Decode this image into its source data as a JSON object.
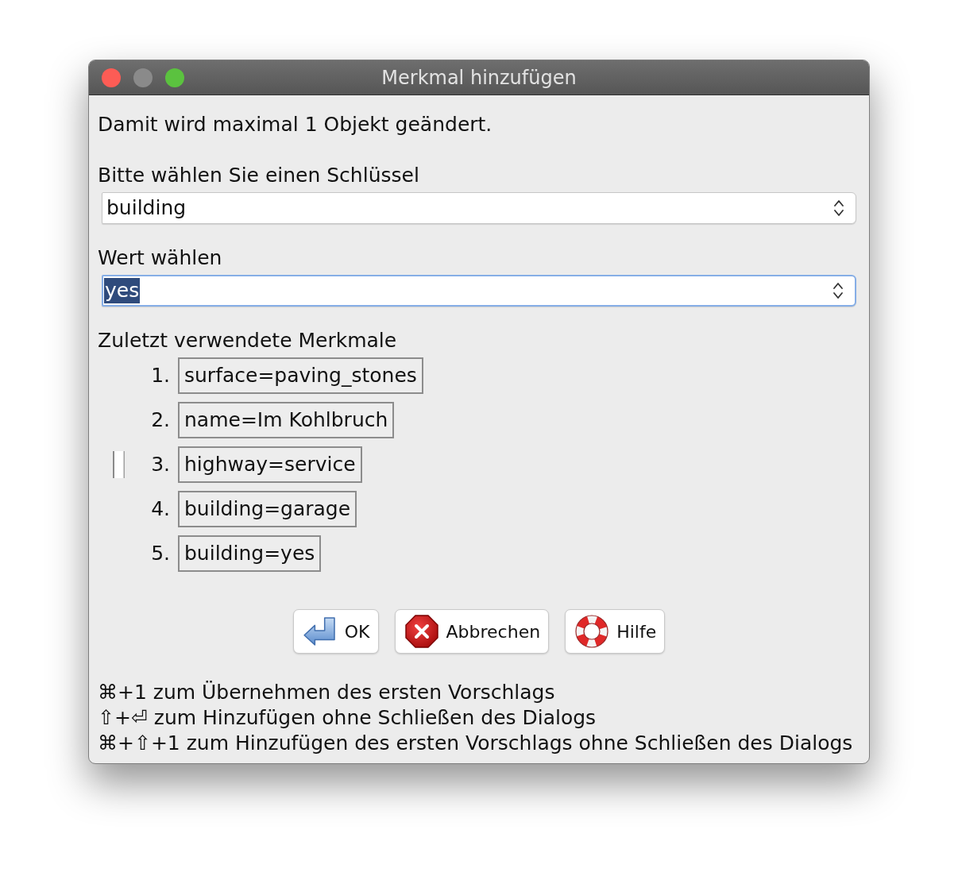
{
  "window": {
    "title": "Merkmal hinzufügen",
    "minimize_enabled": false
  },
  "info": "Damit wird maximal 1 Objekt geändert.",
  "key_field": {
    "label": "Bitte wählen Sie einen Schlüssel",
    "value": "building",
    "focused": false,
    "text_selected": false
  },
  "value_field": {
    "label": "Wert wählen",
    "value": "yes",
    "focused": true,
    "text_selected": true
  },
  "recent": {
    "heading": "Zuletzt verwendete Merkmale",
    "items": [
      {
        "number": "1.",
        "tag": "surface=paving_stones",
        "marked": false
      },
      {
        "number": "2.",
        "tag": "name=Im Kohlbruch",
        "marked": false
      },
      {
        "number": "3.",
        "tag": "highway=service",
        "marked": true
      },
      {
        "number": "4.",
        "tag": "building=garage",
        "marked": false
      },
      {
        "number": "5.",
        "tag": "building=yes",
        "marked": false
      }
    ]
  },
  "buttons": [
    {
      "kind": "ok",
      "label": "OK"
    },
    {
      "kind": "cancel",
      "label": "Abbrechen"
    },
    {
      "kind": "help",
      "label": "Hilfe"
    }
  ],
  "hints": [
    "⌘+1 zum Übernehmen des ersten Vorschlags",
    "⇧+⏎ zum Hinzufügen ohne Schließen des Dialogs",
    "⌘+⇧+1 zum Hinzufügen des ersten Vorschlags ohne Schließen des Dialogs"
  ]
}
